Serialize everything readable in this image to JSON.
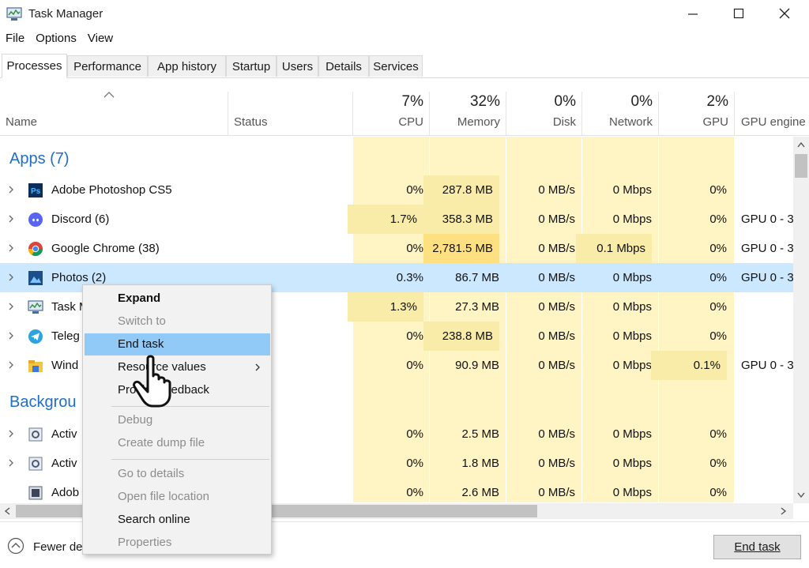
{
  "window": {
    "title": "Task Manager"
  },
  "menu": [
    "File",
    "Options",
    "View"
  ],
  "tabs": [
    "Processes",
    "Performance",
    "App history",
    "Startup",
    "Users",
    "Details",
    "Services"
  ],
  "active_tab": "Processes",
  "columns": {
    "name": "Name",
    "status": "Status",
    "cpu": {
      "pct": "7%",
      "label": "CPU"
    },
    "memory": {
      "pct": "32%",
      "label": "Memory"
    },
    "disk": {
      "pct": "0%",
      "label": "Disk"
    },
    "network": {
      "pct": "0%",
      "label": "Network"
    },
    "gpu": {
      "pct": "2%",
      "label": "GPU"
    },
    "gpu_engine": "GPU engine"
  },
  "groups": {
    "apps": "Apps (7)",
    "background": "Backgrou"
  },
  "processes": [
    {
      "name": "Adobe Photoshop CS5",
      "icon": "photoshop-icon",
      "cpu": "0%",
      "memory": "287.8 MB",
      "disk": "0 MB/s",
      "network": "0 Mbps",
      "gpu": "0%",
      "gpu_engine": ""
    },
    {
      "name": "Discord (6)",
      "icon": "discord-icon",
      "cpu": "1.7%",
      "memory": "358.3 MB",
      "disk": "0 MB/s",
      "network": "0 Mbps",
      "gpu": "0%",
      "gpu_engine": "GPU 0 - 3"
    },
    {
      "name": "Google Chrome (38)",
      "icon": "chrome-icon",
      "cpu": "0%",
      "memory": "2,781.5 MB",
      "disk": "0 MB/s",
      "network": "0.1 Mbps",
      "gpu": "0%",
      "gpu_engine": "GPU 0 - 3"
    },
    {
      "name": "Photos (2)",
      "icon": "photos-icon",
      "cpu": "0.3%",
      "memory": "86.7 MB",
      "disk": "0 MB/s",
      "network": "0 Mbps",
      "gpu": "0%",
      "gpu_engine": "GPU 0 - 3"
    },
    {
      "name": "Task M",
      "icon": "task-manager-icon",
      "cpu": "1.3%",
      "memory": "27.3 MB",
      "disk": "0 MB/s",
      "network": "0 Mbps",
      "gpu": "0%",
      "gpu_engine": ""
    },
    {
      "name": "Teleg",
      "icon": "telegram-icon",
      "cpu": "0%",
      "memory": "238.8 MB",
      "disk": "0 MB/s",
      "network": "0 Mbps",
      "gpu": "0%",
      "gpu_engine": ""
    },
    {
      "name": "Wind",
      "icon": "explorer-icon",
      "cpu": "0%",
      "memory": "90.9 MB",
      "disk": "0 MB/s",
      "network": "0 Mbps",
      "gpu": "0.1%",
      "gpu_engine": "GPU 0 - 3"
    }
  ],
  "background_processes": [
    {
      "name": "Activ",
      "icon": "service-icon",
      "cpu": "0%",
      "memory": "2.5 MB",
      "disk": "0 MB/s",
      "network": "0 Mbps",
      "gpu": "0%"
    },
    {
      "name": "Activ",
      "icon": "service-icon",
      "cpu": "0%",
      "memory": "1.8 MB",
      "disk": "0 MB/s",
      "network": "0 Mbps",
      "gpu": "0%"
    },
    {
      "name": "Adob",
      "icon": "adobe-service-icon",
      "cpu": "0%",
      "memory": "2.6 MB",
      "disk": "0 MB/s",
      "network": "0 Mbps",
      "gpu": "0%"
    }
  ],
  "context_menu": [
    {
      "label": "Expand",
      "state": "bold"
    },
    {
      "label": "Switch to",
      "state": "disabled"
    },
    {
      "label": "End task",
      "state": "highlighted"
    },
    {
      "label": "Resource values",
      "state": "normal",
      "submenu": true
    },
    {
      "label": "Provide feedback",
      "state": "normal"
    },
    {
      "label": "Debug",
      "state": "disabled"
    },
    {
      "label": "Create dump file",
      "state": "disabled"
    },
    {
      "label": "Go to details",
      "state": "disabled"
    },
    {
      "label": "Open file location",
      "state": "disabled"
    },
    {
      "label": "Search online",
      "state": "normal"
    },
    {
      "label": "Properties",
      "state": "disabled"
    }
  ],
  "footer": {
    "fewer_details": "Fewer de",
    "end_task": "End task"
  },
  "colors": {
    "heat_light": "#fff4c4",
    "heat_medium": "#f9eca8",
    "heat_strong": "#ffe080",
    "selection": "#cce8ff",
    "menu_highlight": "#91c9f7",
    "group_text": "#1e6fc8"
  }
}
